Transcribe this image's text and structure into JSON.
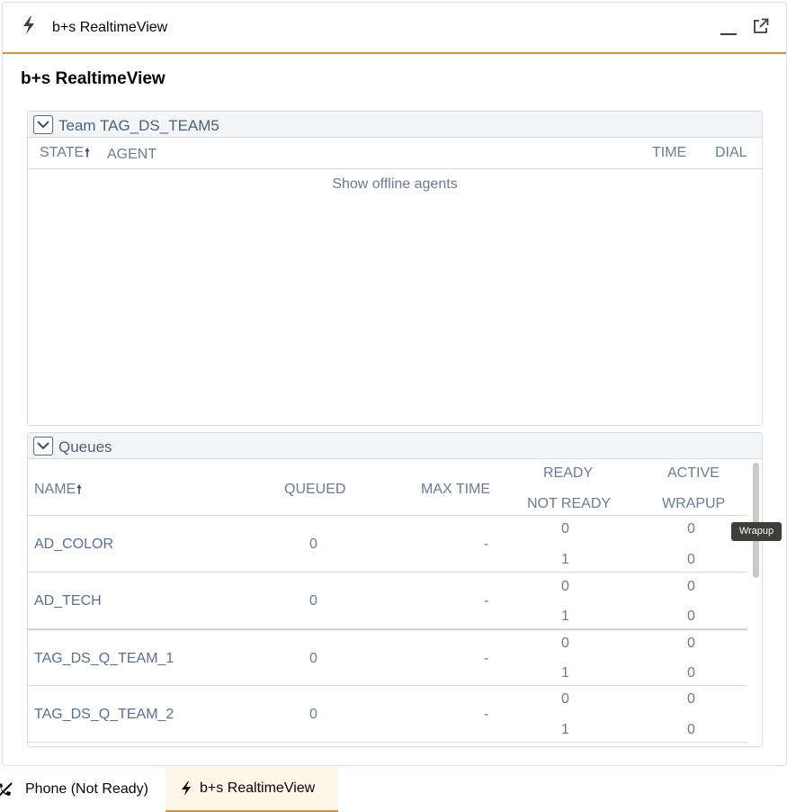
{
  "panel": {
    "title": "b+s RealtimeView",
    "icons": [
      "bolt-icon",
      "minimize-icon",
      "popout-icon"
    ]
  },
  "content": {
    "title": "b+s RealtimeView"
  },
  "team": {
    "label": "Team TAG_DS_TEAM5",
    "columns": {
      "state": "STATE",
      "agent": "AGENT",
      "time": "TIME",
      "dial": "DIAL"
    },
    "sort_indicator": "🠕",
    "show_offline": "Show offline agents"
  },
  "queues": {
    "label": "Queues",
    "columns": {
      "name": "NAME",
      "queued": "QUEUED",
      "max_time": "MAX TIME",
      "ready": "READY",
      "not_ready": "NOT READY",
      "active": "ACTIVE",
      "wrapup": "WRAPUP"
    },
    "rows": [
      {
        "name": "AD_COLOR",
        "queued": "0",
        "max_time": "-",
        "ready": "0",
        "not_ready": "1",
        "active": "0",
        "wrapup": "0"
      },
      {
        "name": "AD_TECH",
        "queued": "0",
        "max_time": "-",
        "ready": "0",
        "not_ready": "1",
        "active": "0",
        "wrapup": "0"
      },
      {
        "name": "TAG_DS_Q_TEAM_1",
        "queued": "0",
        "max_time": "-",
        "ready": "0",
        "not_ready": "1",
        "active": "0",
        "wrapup": "0"
      },
      {
        "name": "TAG_DS_Q_TEAM_2",
        "queued": "0",
        "max_time": "-",
        "ready": "0",
        "not_ready": "1",
        "active": "0",
        "wrapup": "0"
      }
    ]
  },
  "tooltip": "Wrapup",
  "utility_bar": {
    "phone": "Phone (Not Ready)",
    "realtimeview": "b+s RealtimeView"
  },
  "colors": {
    "accent": "#c7964a",
    "header_bg": "#f3f5f9",
    "muted_text": "#6b7b93"
  }
}
